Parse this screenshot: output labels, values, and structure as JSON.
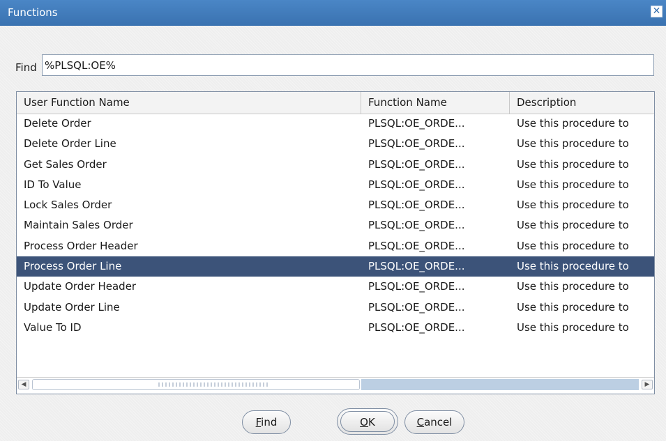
{
  "window": {
    "title": "Functions",
    "close_icon": "close-icon"
  },
  "search": {
    "label": "Find",
    "value": "%PLSQL:OE%"
  },
  "table": {
    "columns": [
      "User Function Name",
      "Function Name",
      "Description"
    ],
    "selected_index": 7,
    "rows": [
      [
        "Delete Order",
        "PLSQL:OE_ORDE...",
        "Use this procedure to"
      ],
      [
        "Delete Order Line",
        "PLSQL:OE_ORDE...",
        "Use this procedure to"
      ],
      [
        "Get Sales Order",
        "PLSQL:OE_ORDE...",
        "Use this procedure to"
      ],
      [
        "ID To Value",
        "PLSQL:OE_ORDE...",
        "Use this procedure to"
      ],
      [
        "Lock Sales Order",
        "PLSQL:OE_ORDE...",
        "Use this procedure to"
      ],
      [
        "Maintain Sales Order",
        "PLSQL:OE_ORDE...",
        "Use this procedure to"
      ],
      [
        "Process Order Header",
        "PLSQL:OE_ORDE...",
        "Use this procedure to"
      ],
      [
        "Process Order Line",
        "PLSQL:OE_ORDE...",
        "Use this procedure to"
      ],
      [
        "Update Order Header",
        "PLSQL:OE_ORDE...",
        "Use this procedure to"
      ],
      [
        "Update Order Line",
        "PLSQL:OE_ORDE...",
        "Use this procedure to"
      ],
      [
        "Value To ID",
        "PLSQL:OE_ORDE...",
        "Use this procedure to"
      ]
    ]
  },
  "buttons": {
    "find": {
      "mnemonic": "F",
      "rest": "ind"
    },
    "ok": {
      "mnemonic": "O",
      "rest": "K"
    },
    "cancel": {
      "mnemonic": "C",
      "rest": "ancel"
    }
  },
  "colors": {
    "title_bar": "#3a72b0",
    "selection": "#3c5379",
    "scroll_track": "#bccfe3"
  }
}
